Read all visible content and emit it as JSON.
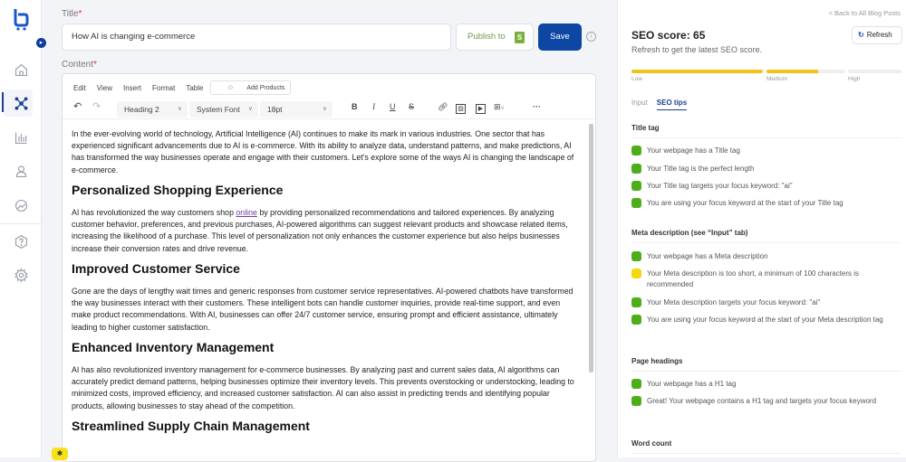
{
  "sidebar": {
    "logo_icon": "cart-b-logo",
    "expand_icon": "chevron-right",
    "items": [
      {
        "name": "home",
        "icon": "home-icon"
      },
      {
        "name": "integrations",
        "icon": "network-icon",
        "active": true
      },
      {
        "name": "analytics",
        "icon": "bar-chart-icon"
      },
      {
        "name": "account",
        "icon": "user-icon"
      },
      {
        "name": "reports",
        "icon": "chart-circle-icon"
      },
      {
        "name": "help",
        "icon": "help-icon"
      },
      {
        "name": "settings",
        "icon": "gear-icon"
      }
    ]
  },
  "form": {
    "title_label": "Title",
    "title_value": "How AI is changing e-commerce",
    "content_label": "Content",
    "required_mark": "*",
    "publish_label": "Publish to",
    "save_label": "Save"
  },
  "editor": {
    "menu": [
      "Edit",
      "View",
      "Insert",
      "Format",
      "Table"
    ],
    "add_products": "Add Products",
    "block_format": "Heading 2",
    "font_family": "System Font",
    "font_size": "18pt",
    "paragraphs": {
      "p1": "In the ever-evolving world of technology, Artificial Intelligence (AI) continues to make its mark in various industries. One sector that has experienced significant advancements due to AI is e-commerce. With its ability to analyze data, understand patterns, and make predictions, AI has transformed the way businesses operate and engage with their customers. Let's explore some of the ways AI is changing the landscape of e-commerce.",
      "h1": "Personalized Shopping Experience",
      "p2a": "AI has revolutionized the way customers shop ",
      "p2link": "online",
      "p2b": " by providing personalized recommendations and tailored experiences. By analyzing customer behavior, preferences, and previous purchases, AI-powered algorithms can suggest relevant products and showcase related items, increasing the likelihood of a purchase. This level of personalization not only enhances the customer experience but also helps businesses increase their conversion rates and drive revenue.",
      "h2": "Improved Customer Service",
      "p3": "Gone are the days of lengthy wait times and generic responses from customer service representatives. AI-powered chatbots have transformed the way businesses interact with their customers. These intelligent bots can handle customer inquiries, provide real-time support, and even make product recommendations. With AI, businesses can offer 24/7 customer service, ensuring prompt and efficient assistance, ultimately leading to higher customer satisfaction.",
      "h3": "Enhanced Inventory Management",
      "p4": "AI has also revolutionized inventory management for e-commerce businesses. By analyzing past and current sales data, AI algorithms can accurately predict demand patterns, helping businesses optimize their inventory levels. This prevents overstocking or understocking, leading to minimized costs, improved efficiency, and increased customer satisfaction. AI can also assist in predicting trends and identifying popular products, allowing businesses to stay ahead of the competition.",
      "h4": "Streamlined Supply Chain Management"
    }
  },
  "seo": {
    "back_link": "< Back to All Blog Posts",
    "score_title": "SEO score: 65",
    "score": 65,
    "subtitle": "Refresh to get the latest SEO score.",
    "refresh_label": "Refresh",
    "levels": [
      {
        "label": "Low",
        "fill": 1.0
      },
      {
        "label": "Medium",
        "fill": 0.65
      },
      {
        "label": "High",
        "fill": 0
      }
    ],
    "tabs": [
      {
        "label": "Input",
        "active": false
      },
      {
        "label": "SEO tips",
        "active": true
      }
    ],
    "colors": {
      "good": "#4caf1a",
      "warn": "#f2d80c",
      "bar": "#f2c11a",
      "accent": "#0d46a3"
    },
    "sections": [
      {
        "title": "Title tag",
        "tips": [
          {
            "status": "good",
            "text": "Your webpage has a Title tag"
          },
          {
            "status": "good",
            "text": "Your Title tag is the perfect length"
          },
          {
            "status": "good",
            "text": "Your Title tag targets your focus keyword: \"ai\""
          },
          {
            "status": "good",
            "text": "You are using your focus keyword at the start of your Title tag"
          }
        ]
      },
      {
        "title": "Meta description (see “Input” tab)",
        "tips": [
          {
            "status": "good",
            "text": "Your webpage has a Meta description"
          },
          {
            "status": "warn",
            "text": "Your Meta description is too short, a minimum of 100 characters is recommended"
          },
          {
            "status": "good",
            "text": "Your Meta description targets your focus keyword: \"ai\""
          },
          {
            "status": "good",
            "text": "You are using your focus keyword at the start of your Meta description tag"
          }
        ]
      },
      {
        "title": "Page headings",
        "tips": [
          {
            "status": "good",
            "text": "Your webpage has a H1 tag"
          },
          {
            "status": "good",
            "text": "Great! Your webpage contains a H1 tag and targets your focus keyword"
          }
        ]
      },
      {
        "title": "Word count",
        "tips": []
      }
    ]
  }
}
